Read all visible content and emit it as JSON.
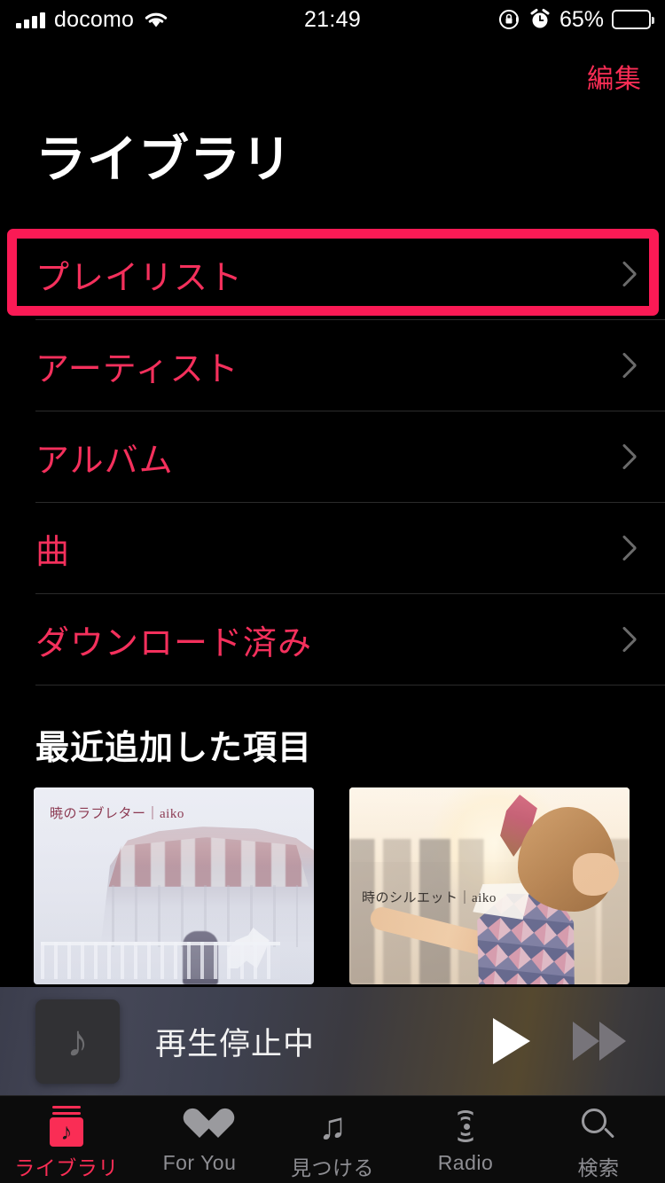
{
  "status_bar": {
    "carrier": "docomo",
    "time": "21:49",
    "battery_percent": "65%",
    "icons": [
      "signal-bars-icon",
      "wifi-icon",
      "rotation-lock-icon",
      "alarm-clock-icon",
      "battery-icon"
    ]
  },
  "nav": {
    "edit_label": "編集",
    "title": "ライブラリ"
  },
  "library_rows": [
    {
      "label": "プレイリスト",
      "highlighted": true
    },
    {
      "label": "アーティスト",
      "highlighted": false
    },
    {
      "label": "アルバム",
      "highlighted": false
    },
    {
      "label": "曲",
      "highlighted": false
    },
    {
      "label": "ダウンロード済み",
      "highlighted": false
    }
  ],
  "section": {
    "title": "最近追加した項目"
  },
  "albums": [
    {
      "caption": "暁のラブレター｜aiko",
      "title": "暁のラブレター",
      "artist": "aiko"
    },
    {
      "caption": "時のシルエット｜aiko",
      "title": "時のシルエット",
      "artist": "aiko"
    }
  ],
  "mini_player": {
    "title": "再生停止中",
    "artwork_icon": "music-note-icon",
    "play_icon": "play-icon",
    "next_icon": "fast-forward-icon"
  },
  "tabs": [
    {
      "label": "ライブラリ",
      "icon": "library-icon",
      "active": true
    },
    {
      "label": "For You",
      "icon": "heart-icon",
      "active": false
    },
    {
      "label": "見つける",
      "icon": "music-note-icon",
      "active": false
    },
    {
      "label": "Radio",
      "icon": "radio-waves-icon",
      "active": false
    },
    {
      "label": "検索",
      "icon": "search-icon",
      "active": false
    }
  ],
  "colors": {
    "accent": "#fa2d55",
    "highlight_border": "#fa1a55",
    "background": "#000000",
    "inactive_tab": "#8e8e93"
  }
}
